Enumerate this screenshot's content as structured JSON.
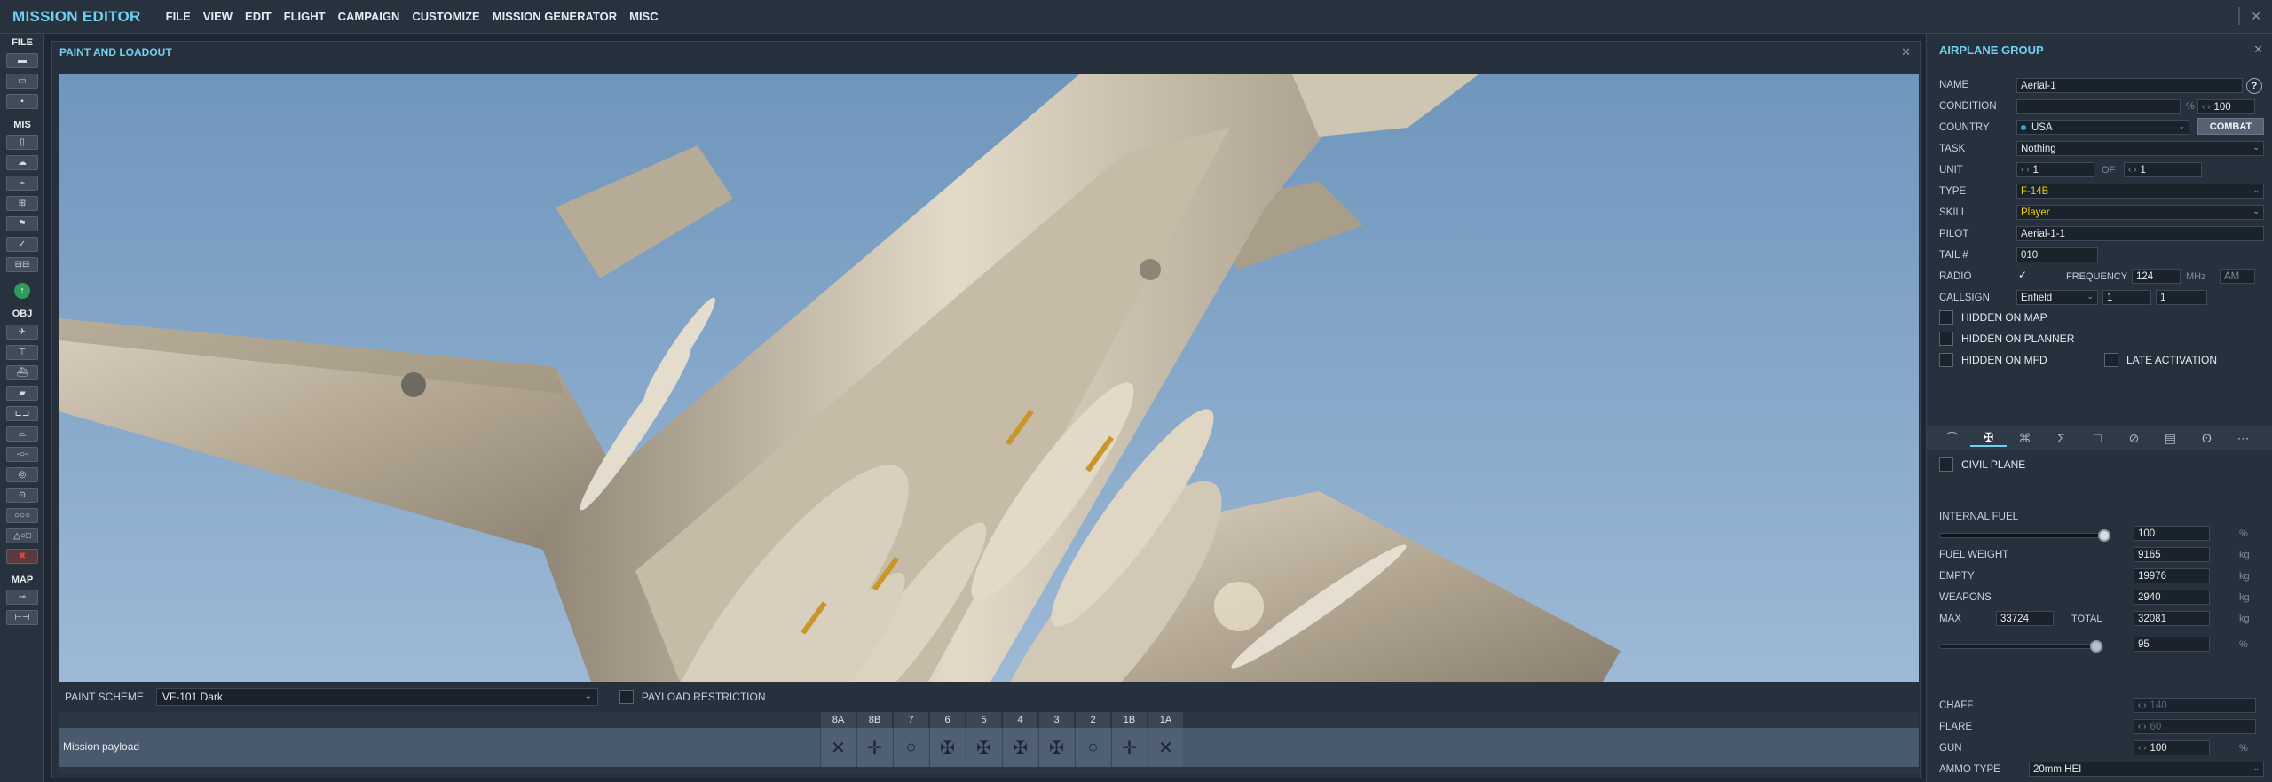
{
  "app": {
    "title": "MISSION EDITOR",
    "close_icon": "close-icon"
  },
  "menu": [
    "FILE",
    "VIEW",
    "EDIT",
    "FLIGHT",
    "CAMPAIGN",
    "CUSTOMIZE",
    "MISSION GENERATOR",
    "MISC"
  ],
  "toolbar": {
    "sections": {
      "file": "FILE",
      "mis": "MIS",
      "obj": "OBJ",
      "map": "MAP"
    },
    "file_tools": [
      "new-file-icon",
      "open-file-icon",
      "save-file-icon"
    ],
    "mis_tools": [
      "briefing-icon",
      "weather-icon",
      "triggers-icon",
      "target-icon",
      "flag-icon",
      "check-icon",
      "resources-icon"
    ],
    "obj_tools": [
      "airplane-icon",
      "helicopter-icon",
      "ship-icon",
      "vehicle-icon",
      "static-object-icon",
      "bridge-icon",
      "nav-point-icon",
      "zone-icon",
      "target-zone-icon",
      "warehouse-icon",
      "shapes-icon",
      "delete-icon"
    ],
    "map_tools": [
      "key-icon",
      "ruler-icon"
    ],
    "green_icon": "arrow-up-circle-icon"
  },
  "paint_window": {
    "title": "PAINT AND LOADOUT",
    "paint_scheme_label": "PAINT SCHEME",
    "paint_scheme_value": "VF-101 Dark",
    "payload_restriction_label": "PAYLOAD RESTRICTION",
    "payload_name": "Mission payload",
    "stations": [
      {
        "label": "8A",
        "glyph": "✕"
      },
      {
        "label": "8B",
        "glyph": "✛"
      },
      {
        "label": "7",
        "glyph": "○"
      },
      {
        "label": "6",
        "glyph": "✠"
      },
      {
        "label": "5",
        "glyph": "✠"
      },
      {
        "label": "4",
        "glyph": "✠"
      },
      {
        "label": "3",
        "glyph": "✠"
      },
      {
        "label": "2",
        "glyph": "○"
      },
      {
        "label": "1B",
        "glyph": "✛"
      },
      {
        "label": "1A",
        "glyph": "✕"
      }
    ]
  },
  "group": {
    "title": "AIRPLANE GROUP",
    "name_label": "NAME",
    "name_value": "Aerial-1",
    "help": "?",
    "condition_label": "CONDITION",
    "condition_pct_unit": "%",
    "condition_value": "100",
    "country_label": "COUNTRY",
    "country_value": "USA",
    "combat_label": "COMBAT",
    "task_label": "TASK",
    "task_value": "Nothing",
    "unit_label": "UNIT",
    "unit_value": "1",
    "of_label": "OF",
    "of_value": "1",
    "type_label": "TYPE",
    "type_value": "F-14B",
    "skill_label": "SKILL",
    "skill_value": "Player",
    "pilot_label": "PILOT",
    "pilot_value": "Aerial-1-1",
    "tail_label": "TAIL #",
    "tail_value": "010",
    "radio_label": "RADIO",
    "frequency_label": "FREQUENCY",
    "frequency_value": "124",
    "mhz_unit": "MHz",
    "modulation": "AM",
    "callsign_label": "CALLSIGN",
    "callsign_value": "Enfield",
    "callsign_num1": "1",
    "callsign_num2": "1",
    "hidden_map_label": "HIDDEN ON MAP",
    "hidden_planner_label": "HIDDEN ON PLANNER",
    "hidden_mfd_label": "HIDDEN ON MFD",
    "late_activation_label": "LATE ACTIVATION",
    "tabs": [
      "route-icon",
      "payload-icon",
      "failures-icon",
      "sigma-icon",
      "square-icon",
      "slash-circle-icon",
      "datalink-icon",
      "radio-tower-icon",
      "more-icon"
    ],
    "tab_glyphs": [
      "⌒",
      "✠",
      "⌘",
      "Σ",
      "□",
      "⊘",
      "▤",
      "ʘ",
      "⋯"
    ],
    "civil_plane_label": "CIVIL PLANE",
    "internal_fuel_label": "INTERNAL FUEL",
    "internal_fuel_value": "100",
    "pct_unit": "%",
    "fuel_level": 1.0,
    "fuel_weight_label": "FUEL WEIGHT",
    "fuel_weight_value": "9165",
    "empty_label": "EMPTY",
    "empty_value": "19976",
    "weapons_label": "WEAPONS",
    "weapons_value": "2940",
    "max_label": "MAX",
    "max_value": "33724",
    "total_label": "TOTAL",
    "total_value": "32081",
    "kg_unit": "kg",
    "total_pct_value": "95",
    "total_level": 0.95,
    "chaff_label": "CHAFF",
    "chaff_value": "140",
    "flare_label": "FLARE",
    "flare_value": "60",
    "gun_label": "GUN",
    "gun_value": "100",
    "ammo_label": "AMMO TYPE",
    "ammo_value": "20mm HEI",
    "colors": {
      "accent": "#6fd0f0",
      "yellow": "#f0d000",
      "country_dot": "#2aa8e0"
    }
  }
}
